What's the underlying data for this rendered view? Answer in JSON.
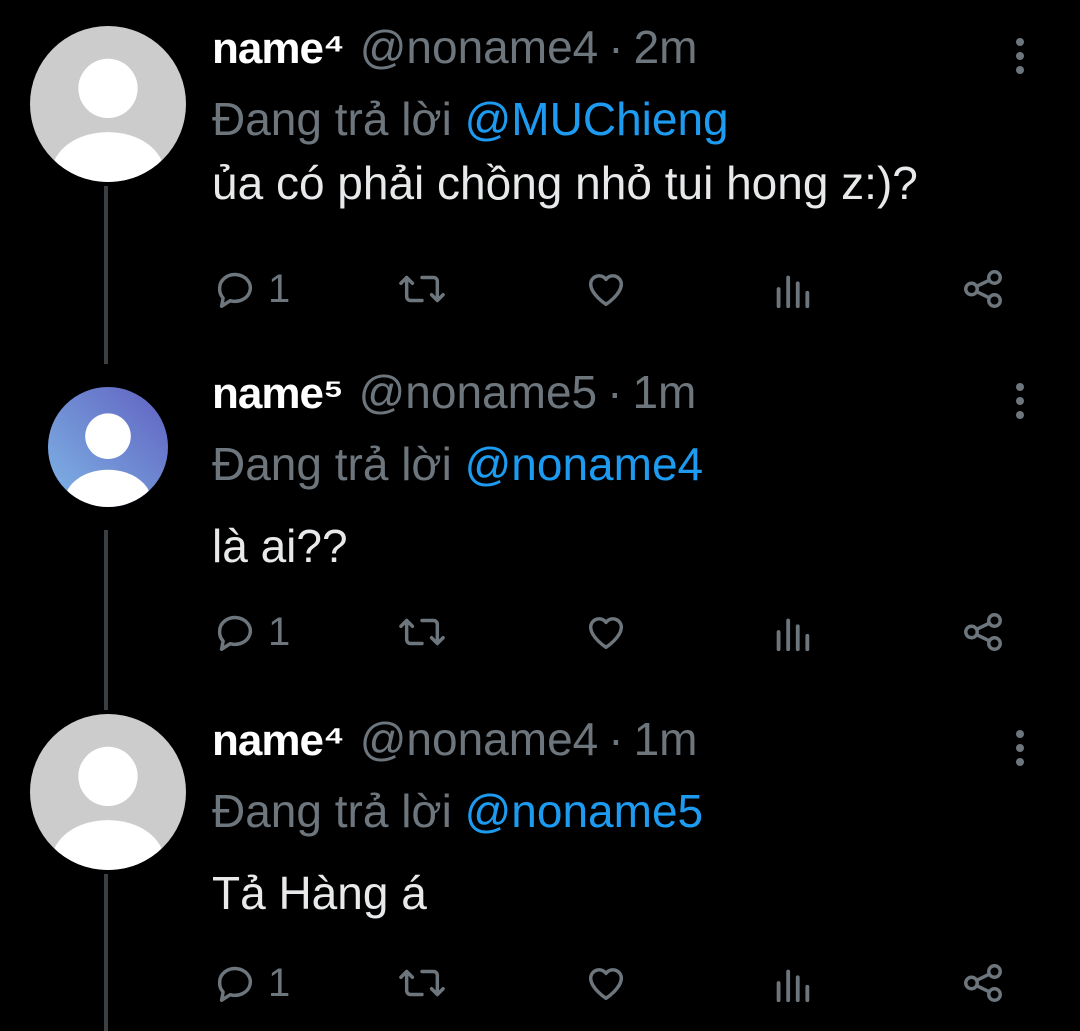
{
  "tweets": [
    {
      "name": "name⁴",
      "handle": "@noname4",
      "separator": "·",
      "time": "2m",
      "reply_prefix": "Đang trả lời",
      "reply_to": "@MUChieng",
      "text": "ủa có phải chồng nhỏ tui hong z:)?",
      "reply_count": "1",
      "avatar_color": "#cccccc"
    },
    {
      "name": "name⁵",
      "handle": "@noname5",
      "separator": "·",
      "time": "1m",
      "reply_prefix": "Đang trả lời",
      "reply_to": "@noname4",
      "text": "là ai??",
      "reply_count": "1",
      "avatar_color": "#6f8fd6"
    },
    {
      "name": "name⁴",
      "handle": "@noname4",
      "separator": "·",
      "time": "1m",
      "reply_prefix": "Đang trả lời",
      "reply_to": "@noname5",
      "text": "Tả Hàng á",
      "reply_count": "1",
      "avatar_color": "#cccccc"
    }
  ],
  "icons": [
    "reply-icon",
    "retweet-icon",
    "like-icon",
    "analytics-icon",
    "share-icon",
    "more-options-icon"
  ],
  "colors": {
    "background": "#000000",
    "mention": "#1d9bf0",
    "muted": "#6e767d",
    "text": "#e7e9ea"
  }
}
